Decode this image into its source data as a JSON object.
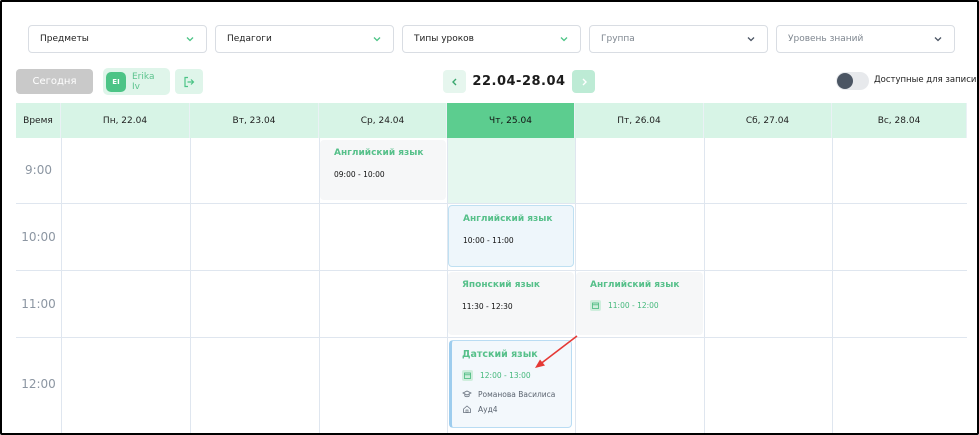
{
  "filters": [
    {
      "label": "Предметы",
      "muted": false
    },
    {
      "label": "Педагоги",
      "muted": false
    },
    {
      "label": "Типы уроков",
      "muted": false
    },
    {
      "label": "Группа",
      "muted": true
    },
    {
      "label": "Уровень знаний",
      "muted": true
    }
  ],
  "toolbar": {
    "today_label": "Сегодня",
    "user_initials": "EI",
    "user_name": "Erika Iv",
    "range_label": "22.04-28.04",
    "toggle_label": "Доступные для записи"
  },
  "calendar": {
    "time_header": "Время",
    "days": [
      {
        "label": "Пн, 22.04",
        "active": false
      },
      {
        "label": "Вт, 23.04",
        "active": false
      },
      {
        "label": "Ср, 24.04",
        "active": false
      },
      {
        "label": "Чт, 25.04",
        "active": true
      },
      {
        "label": "Пт, 26.04",
        "active": false
      },
      {
        "label": "Сб, 27.04",
        "active": false
      },
      {
        "label": "Вс, 28.04",
        "active": false
      }
    ],
    "hours": [
      "9:00",
      "10:00",
      "11:00",
      "12:00"
    ],
    "lessons": {
      "wed_english": {
        "title": "Английский язык",
        "time": "09:00 - 10:00"
      },
      "thu_english": {
        "title": "Английский язык",
        "time": "10:00 - 11:00"
      },
      "thu_japanese": {
        "title": "Японский язык",
        "time": "11:30 - 12:30"
      },
      "fri_english": {
        "title": "Английский язык",
        "time": "11:00 - 12:00"
      },
      "thu_danish": {
        "title": "Датский язык",
        "time": "12:00 - 13:00",
        "teacher": "Романова Василиса",
        "room": "Ауд4"
      }
    }
  },
  "colors": {
    "accent": "#5ccd8f",
    "header_bg": "#d7f4e6",
    "lesson_title": "#56c08a",
    "arrow": "#e53935"
  }
}
